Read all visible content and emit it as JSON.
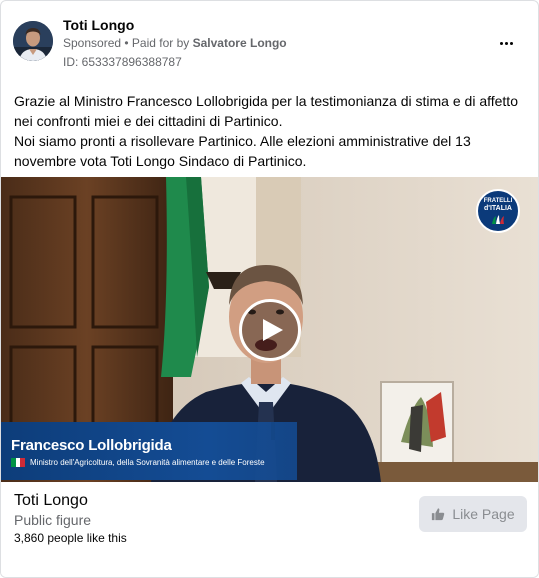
{
  "post": {
    "page_name": "Toti Longo",
    "sponsored_label": "Sponsored",
    "separator": " • ",
    "paid_for_by_label": "Paid for by ",
    "payer": "Salvatore Longo",
    "ad_id": "ID: 653337896388787",
    "more_icon": "more-horizontal-icon",
    "text_lines": [
      "Grazie al Ministro Francesco Lollobrigida per la testimonianza di stima e di affetto nei confronti miei e dei cittadini di Partinico.",
      "Noi siamo pronti a risollevare Partinico. Alle elezioni amministrative del 13 novembre vota Toti Longo Sindaco di Partinico."
    ]
  },
  "video": {
    "play_icon": "play-icon",
    "logo": {
      "line1": "FRATELLI",
      "line2": "d'ITALIA"
    },
    "caption_name": "Francesco Lollobrigida",
    "caption_role": "Ministro dell'Agricoltura, della Sovranità alimentare e delle Foreste",
    "flag_colors": [
      "#009246",
      "#ffffff",
      "#ce2b37"
    ],
    "caption_bg": "#144c94"
  },
  "footer": {
    "page_name": "Toti Longo",
    "category": "Public figure",
    "likes": "3,860 people like this",
    "like_button_label": "Like Page",
    "like_icon": "thumbs-up-icon"
  },
  "colors": {
    "text_primary": "#050505",
    "text_secondary": "#65676b",
    "button_bg": "#e4e6eb",
    "button_text": "#8a8d91"
  }
}
